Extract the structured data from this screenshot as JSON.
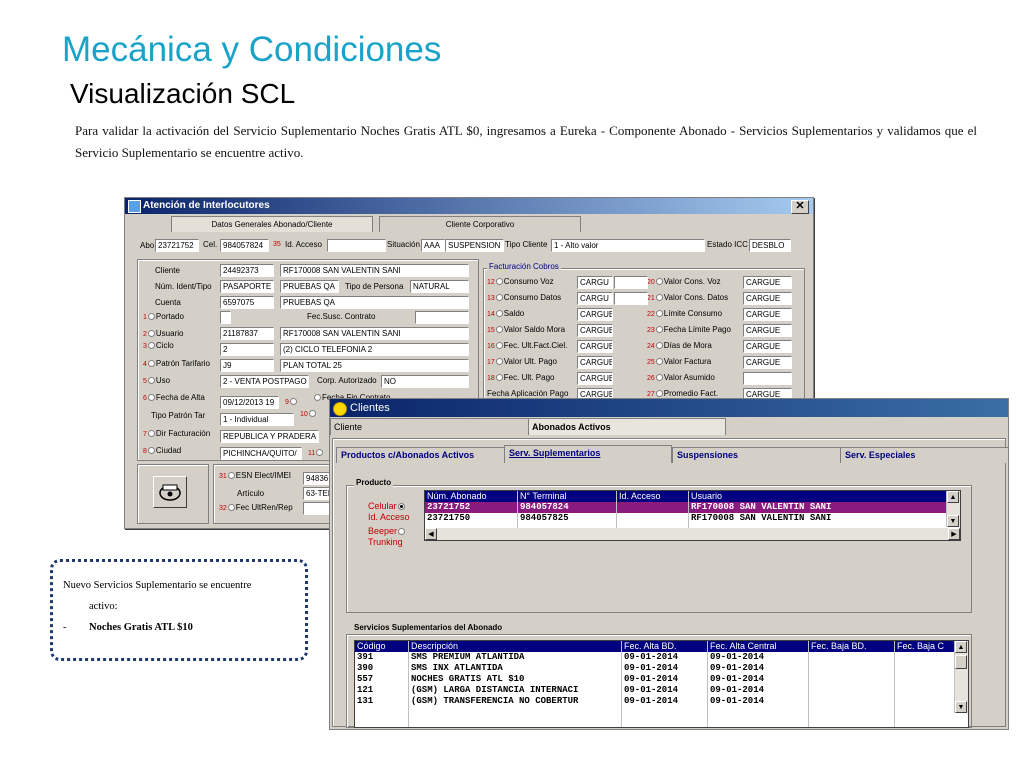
{
  "slide": {
    "title": "Mecánica y Condiciones",
    "subtitle": "Visualización SCL",
    "paragraph": "Para validar la activación del Servicio Suplementario Noches Gratis ATL $0, ingresamos a Eureka - Componente Abonado - Servicios Suplementarios y validamos que el Servicio Suplementario se encuentre activo."
  },
  "note": {
    "line1": "Nuevo Servicios Suplementario se encuentre",
    "line2": "activo:",
    "bullet": "-",
    "item": "Noches Gratis ATL $10"
  },
  "win1": {
    "title": "Atención de Interlocutores",
    "close": "✕",
    "tabs": [
      "Datos Generales Abonado/Cliente",
      "Cliente Corporativo"
    ],
    "top": {
      "abo_label": "Abo",
      "abo": "23721752",
      "cel_label": "Cel.",
      "cel": "984057824",
      "acc_num": "35",
      "acc_label": "Id. Acceso",
      "acc": "",
      "sit_label": "Situación",
      "sit_code": "AAA",
      "sit": "SUSPENSION",
      "tc_label": "Tipo Cliente",
      "tc": "1 - Alto valor",
      "icc_label": "Estado ICC",
      "icc": "DESBLO"
    },
    "left": {
      "cliente_label": "Cliente",
      "cliente_id": "24492373",
      "cliente_name": "RF170008 SAN VALENTIN SANI",
      "ident_label": "Núm. Ident/Tipo",
      "ident_type": "PASAPORTE",
      "ident_val": "PRUEBAS QA",
      "persona_label": "Tipo de Persona",
      "persona": "NATURAL",
      "cuenta_label": "Cuenta",
      "cuenta_id": "6597075",
      "cuenta_name": "PRUEBAS QA",
      "portado_num": "1",
      "portado_label": "Portado",
      "fec_susc_label": "Fec.Susc. Contrato",
      "usuario_num": "2",
      "usuario_label": "Usuario",
      "usuario_id": "21187837",
      "usuario_name": "RF170008 SAN VALENTIN SANI",
      "ciclo_num": "3",
      "ciclo_label": "Ciclo",
      "ciclo_id": "2",
      "ciclo_name": "(2) CICLO TELEFONIA 2",
      "plan_num": "4",
      "plan_label": "Patrón Tarifario",
      "plan_id": "J9",
      "plan_name": "PLAN TOTAL 25",
      "uso_num": "5",
      "uso_label": "Uso",
      "uso": "2 - VENTA POSTPAGO",
      "corp_label": "Corp. Autorizado",
      "corp": "NO",
      "alta_num": "6",
      "alta_label": "Fecha de Alta",
      "alta": "09/12/2013 19",
      "alta_n2": "9",
      "fec_contrato_label": "Fecha Fin Contrato",
      "tipo_patron_label": "Tipo Patrón Tar",
      "tipo_patron": "1 - Individual",
      "tp_n2": "10",
      "dir_num": "7",
      "dir_label": "Dir Facturación",
      "dir": "REPUBLICA Y PRADERA",
      "ciudad_num": "8",
      "ciudad_label": "Ciudad",
      "ciudad": "PICHINCHA/QUITO/",
      "ciudad_n2": "11",
      "esn_num": "31",
      "esn_label": "ESN Elect/IMEI",
      "esn": "94836",
      "articulo_label": "Artículo",
      "articulo": "63-TEI",
      "fec_ult_num": "32",
      "fec_ult_label": "Fec UltRen/Rep"
    },
    "fact": {
      "group_label": "Facturación Cobros",
      "rows_left": [
        {
          "n": "12",
          "label": "Consumo Voz",
          "val": "CARGU"
        },
        {
          "n": "13",
          "label": "Consumo Datos",
          "val": "CARGU"
        },
        {
          "n": "14",
          "label": "Saldo",
          "val": "CARGUE"
        },
        {
          "n": "15",
          "label": "Valor Saldo Mora",
          "val": "CARGUE"
        },
        {
          "n": "16",
          "label": "Fec. Ult.Fact.Ciel.",
          "val": "CARGUE"
        },
        {
          "n": "17",
          "label": "Valor Ult. Pago",
          "val": "CARGUE"
        },
        {
          "n": "18",
          "label": "Fec. Ult. Pago",
          "val": "CARGUE"
        },
        {
          "n": "",
          "label": "Fecha Aplicación Pago",
          "val": "CARGUE"
        }
      ],
      "rows_right": [
        {
          "n": "20",
          "label": "Valor Cons. Voz",
          "val": "CARGUE"
        },
        {
          "n": "21",
          "label": "Valor Cons. Datos",
          "val": "CARGUE"
        },
        {
          "n": "22",
          "label": "Límite Consumo",
          "val": "CARGUE"
        },
        {
          "n": "23",
          "label": "Fecha Límite Pago",
          "val": "CARGUE"
        },
        {
          "n": "24",
          "label": "Días de Mora",
          "val": "CARGUE"
        },
        {
          "n": "25",
          "label": "Valor Factura",
          "val": "CARGUE"
        },
        {
          "n": "26",
          "label": "Valor Asumido",
          "val": ""
        },
        {
          "n": "27",
          "label": "Promedio Fact.",
          "val": "CARGUE"
        }
      ]
    }
  },
  "win2": {
    "title": "Clientes",
    "tabs_top": [
      "Cliente",
      "Abonados Activos"
    ],
    "tabs_sub": [
      "Productos  c/Abonados Activos",
      "Serv. Suplementarios",
      "Suspensiones",
      "Serv. Especiales"
    ],
    "producto": {
      "group_label": "Producto",
      "radios": [
        "Celular",
        "Id. Acceso",
        "Beeper",
        "Trunking"
      ],
      "headers": [
        "Núm. Abonado",
        "N° Terminal",
        "Id. Acceso",
        "Usuario"
      ],
      "rows": [
        [
          "23721752",
          "984057824",
          "",
          "RF170008 SAN VALENTIN SANI"
        ],
        [
          "23721750",
          "984057825",
          "",
          "RF170008 SAN VALENTIN SANI"
        ]
      ]
    },
    "servicios": {
      "group_label": "Servicios Suplementarios del Abonado",
      "headers": [
        "Código",
        "Descripción",
        "Fec. Alta BD.",
        "Fec. Alta Central",
        "Fec. Baja BD.",
        "Fec. Baja C"
      ],
      "rows": [
        [
          "391",
          "SMS PREMIUM ATLANTIDA",
          "09-01-2014",
          "09-01-2014"
        ],
        [
          "390",
          "SMS INX ATLANTIDA",
          "09-01-2014",
          "09-01-2014"
        ],
        [
          "557",
          "NOCHES GRATIS ATL $10",
          "09-01-2014",
          "09-01-2014"
        ],
        [
          "121",
          "(GSM) LARGA DISTANCIA INTERNACI",
          "09-01-2014",
          "09-01-2014"
        ],
        [
          "131",
          "(GSM) TRANSFERENCIA NO COBERTUR",
          "09-01-2014",
          "09-01-2014"
        ]
      ]
    },
    "scroll": {
      "up": "▲",
      "down": "▼",
      "left": "◀",
      "right": "▶"
    }
  }
}
